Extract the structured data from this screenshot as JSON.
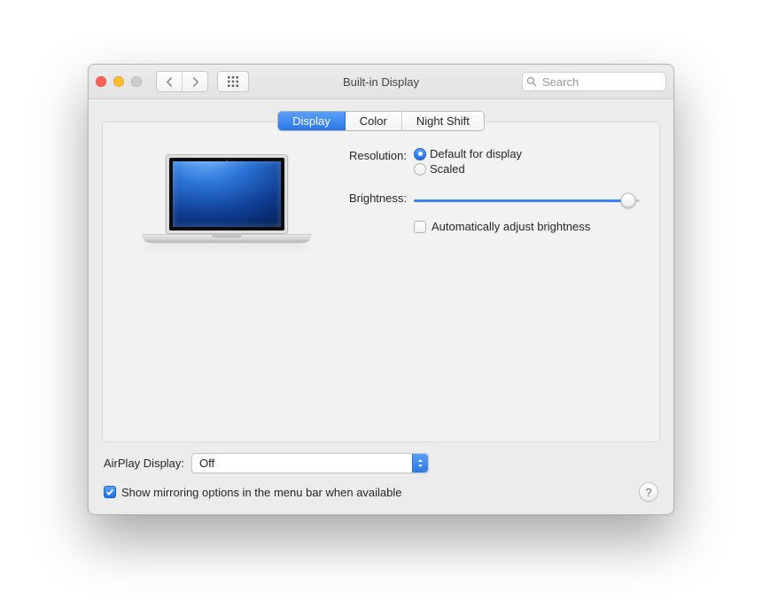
{
  "window": {
    "title": "Built-in Display",
    "search_placeholder": "Search"
  },
  "tabs": {
    "display": "Display",
    "color": "Color",
    "night_shift": "Night Shift",
    "selected": 0
  },
  "settings": {
    "resolution_label": "Resolution:",
    "resolution_options": {
      "default": "Default for display",
      "scaled": "Scaled"
    },
    "resolution_selected": "default",
    "brightness_label": "Brightness:",
    "brightness_value": 95,
    "auto_brightness_label": "Automatically adjust brightness",
    "auto_brightness_checked": false
  },
  "airplay": {
    "label": "AirPlay Display:",
    "value": "Off"
  },
  "mirroring": {
    "label": "Show mirroring options in the menu bar when available",
    "checked": true
  },
  "help_glyph": "?"
}
